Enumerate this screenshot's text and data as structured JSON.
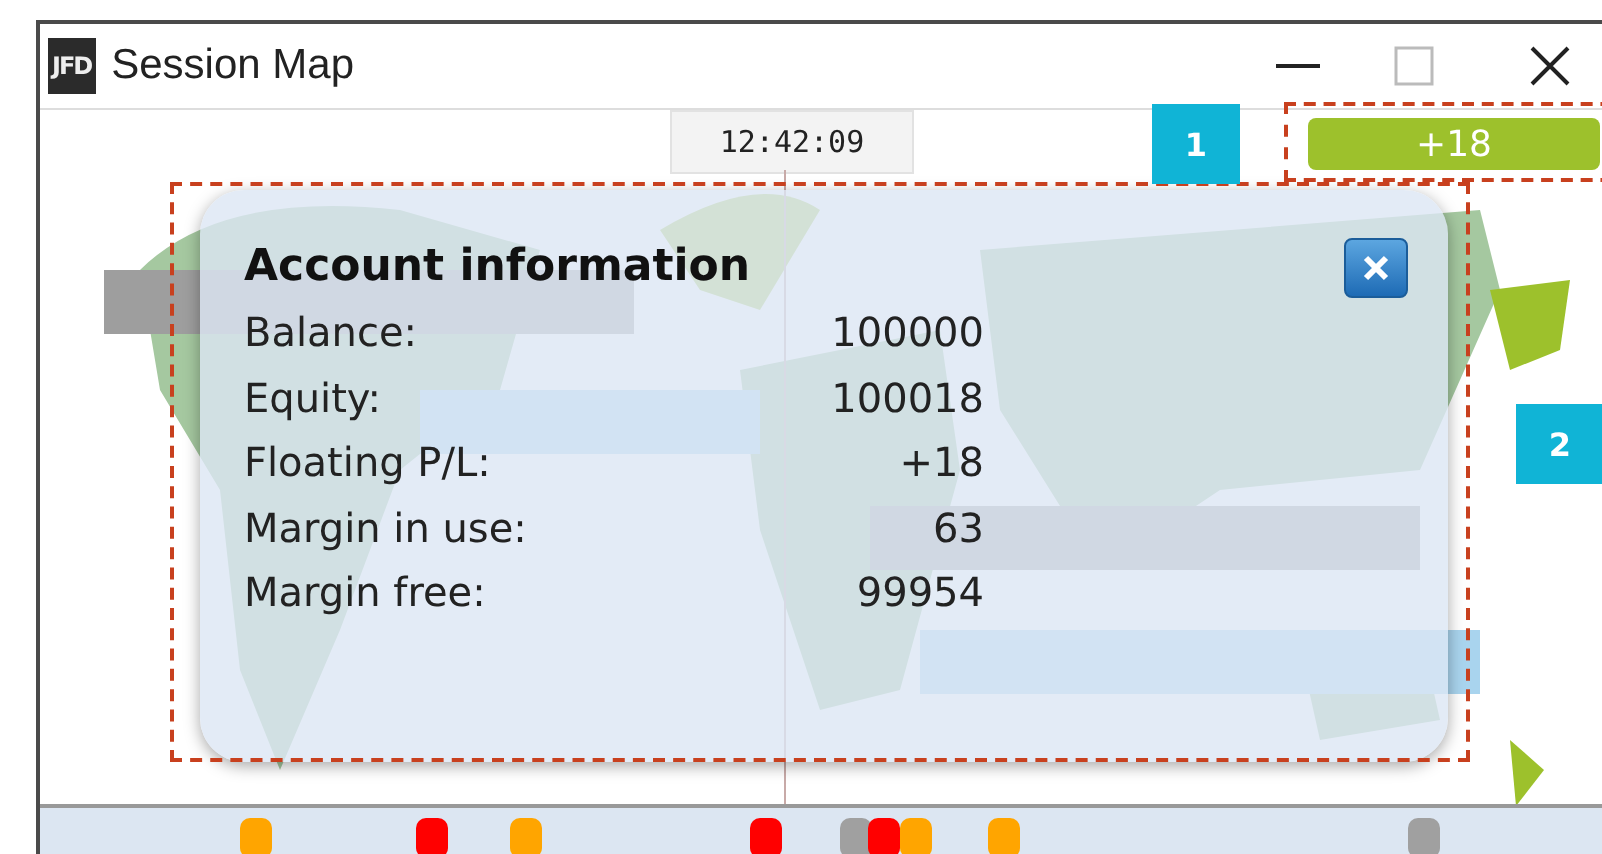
{
  "window": {
    "logo": "JFD",
    "title": "Session Map"
  },
  "clock": "12:42:09",
  "pl_badge": "+18",
  "account_popup": {
    "title": "Account information",
    "rows": [
      {
        "label": "Balance:",
        "value": "100000"
      },
      {
        "label": "Equity:",
        "value": "100018"
      },
      {
        "label": "Floating P/L:",
        "value": "+18"
      },
      {
        "label": "Margin in use:",
        "value": "63"
      },
      {
        "label": "Margin free:",
        "value": "99954"
      }
    ]
  },
  "timeline_markers": [
    {
      "color": "#ffa500"
    },
    {
      "color": "#ff0000"
    },
    {
      "color": "#ffa500"
    },
    {
      "color": "#ff0000"
    },
    {
      "color": "#a0a0a0"
    },
    {
      "color": "#ff0000"
    },
    {
      "color": "#ffa500"
    },
    {
      "color": "#ffa500"
    },
    {
      "color": "#a0a0a0"
    }
  ],
  "callouts": [
    "1",
    "2"
  ]
}
